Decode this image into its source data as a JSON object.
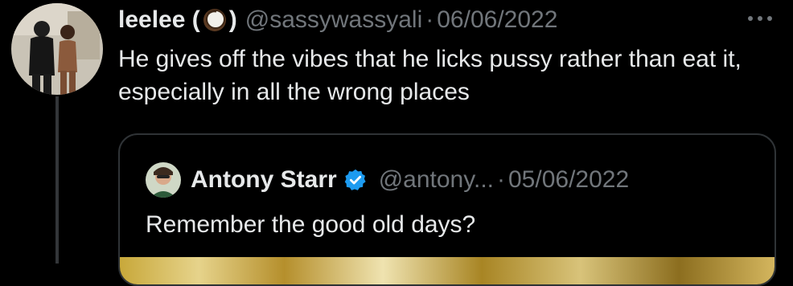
{
  "tweet": {
    "display_name_before": "leelee (",
    "display_name_after": ")",
    "handle": "@sassywassyali",
    "separator": "·",
    "date": "06/06/2022",
    "text": "He gives off the vibes that he licks pussy rather than eat it, especially in all the wrong places",
    "name_emoji": "coconut-icon"
  },
  "quote": {
    "display_name": "Antony Starr",
    "verified": true,
    "handle": "@antony...",
    "separator": "·",
    "date": "05/06/2022",
    "text": "Remember the good old days?"
  },
  "colors": {
    "background": "#000000",
    "text_primary": "#e7e9ea",
    "text_secondary": "#71767b",
    "verified_blue": "#1d9bf0",
    "border": "#2f3336"
  },
  "icons": {
    "more": "more-horizontal-icon",
    "verified": "verified-badge-icon"
  }
}
